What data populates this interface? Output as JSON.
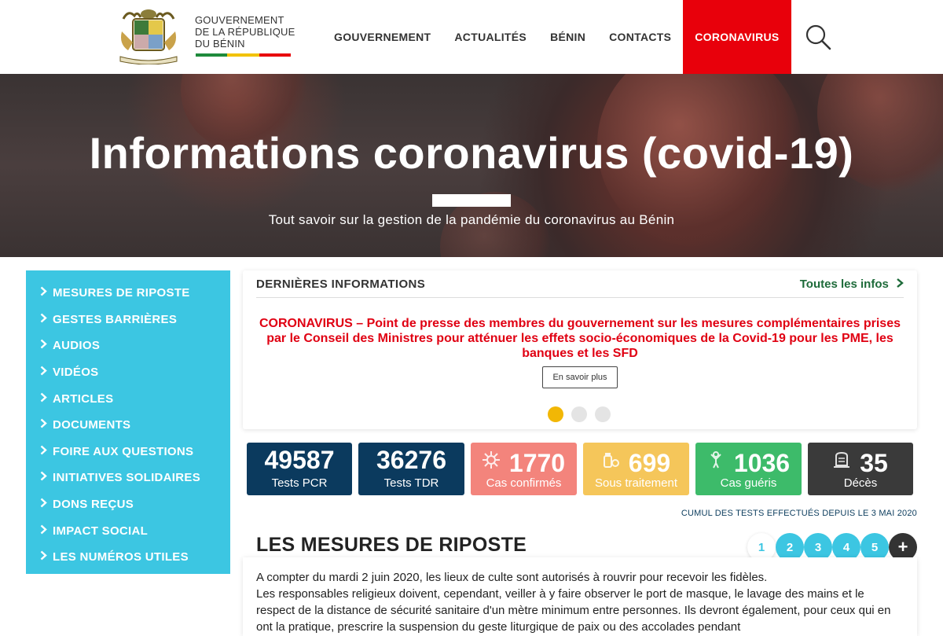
{
  "header": {
    "logo_lines": [
      "GOUVERNEMENT",
      "DE LA RÉPUBLIQUE",
      "DU BÉNIN"
    ],
    "flag_colors": [
      "#1e8a3c",
      "#f2c200",
      "#e8000b"
    ],
    "nav": [
      "GOUVERNEMENT",
      "ACTUALITÉS",
      "BÉNIN",
      "CONTACTS",
      "CORONAVIRUS"
    ],
    "active_nav": "CORONAVIRUS",
    "search_icon": "search-icon"
  },
  "hero": {
    "title": "Informations coronavirus (covid-19)",
    "subtitle": "Tout savoir sur la gestion de la pandémie du coronavirus au Bénin"
  },
  "sidebar": {
    "items": [
      "MESURES DE RIPOSTE",
      "GESTES BARRIÈRES",
      "AUDIOS",
      "VIDÉOS",
      "ARTICLES",
      "DOCUMENTS",
      "FOIRE AUX QUESTIONS",
      "INITIATIVES SOLIDAIRES",
      "DONS REÇUS",
      "IMPACT SOCIAL",
      "LES NUMÉROS UTILES"
    ],
    "color": "#3cc6e2"
  },
  "news": {
    "heading": "DERNIÈRES INFORMATIONS",
    "all_link": "Toutes les infos",
    "headline": "CORONAVIRUS – Point de presse des membres du gouvernement sur les mesures complémentaires prises par le Conseil des Ministres pour atténuer les effets socio-économiques de la Covid-19 pour les PME, les banques et les SFD",
    "button": "En savoir plus",
    "slides": 3,
    "active_slide": 1
  },
  "stats": [
    {
      "value": "49587",
      "label": "Tests PCR",
      "color": "#0b3a5e",
      "icon": ""
    },
    {
      "value": "36276",
      "label": "Tests TDR",
      "color": "#0b3a5e",
      "icon": ""
    },
    {
      "value": "1770",
      "label": "Cas confirmés",
      "color": "#f3847c",
      "icon": "virus-icon"
    },
    {
      "value": "699",
      "label": "Sous traitement",
      "color": "#f5c65a",
      "icon": "pills-icon"
    },
    {
      "value": "1036",
      "label": "Cas guéris",
      "color": "#3dbb6a",
      "icon": "person-icon"
    },
    {
      "value": "35",
      "label": "Décès",
      "color": "#3a3a3a",
      "icon": "tombstone-icon"
    }
  ],
  "cumul_note": "CUMUL DES TESTS EFFECTUÉS DEPUIS LE 3 MAI 2020",
  "mesures": {
    "title": "LES MESURES DE RIPOSTE",
    "pages": [
      "1",
      "2",
      "3",
      "4",
      "5"
    ],
    "current_page": "1",
    "plus": "+",
    "paragraphs": [
      "A compter du mardi 2 juin 2020, les lieux de culte sont autorisés à rouvrir pour recevoir les fidèles.",
      "Les responsables religieux doivent, cependant, veiller à y faire observer le port de masque, le lavage des mains et le respect de la distance de sécurité sanitaire d'un mètre minimum entre personnes. Ils devront également, pour ceux qui en ont la pratique, prescrire la suspension du geste liturgique de paix ou des accolades pendant"
    ]
  }
}
